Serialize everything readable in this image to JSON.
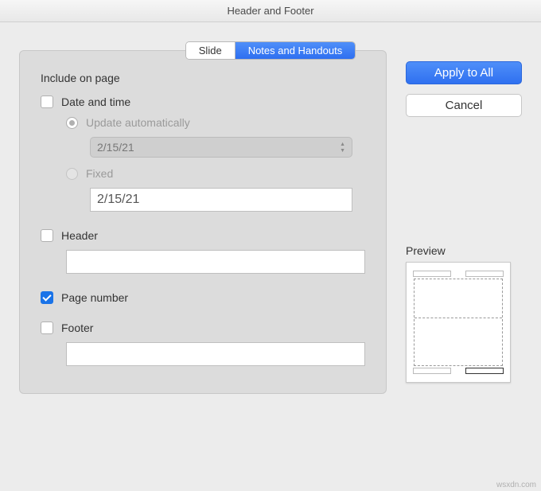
{
  "title": "Header and Footer",
  "tabs": {
    "slide": "Slide",
    "notes": "Notes and Handouts"
  },
  "group_title": "Include on page",
  "datetime": {
    "label": "Date and time",
    "auto_label": "Update automatically",
    "auto_value": "2/15/21",
    "fixed_label": "Fixed",
    "fixed_value": "2/15/21"
  },
  "header": {
    "label": "Header",
    "value": ""
  },
  "pagenum": {
    "label": "Page number"
  },
  "footer": {
    "label": "Footer",
    "value": ""
  },
  "buttons": {
    "apply_all": "Apply to All",
    "cancel": "Cancel"
  },
  "preview_label": "Preview",
  "watermark": "wsxdn.com"
}
